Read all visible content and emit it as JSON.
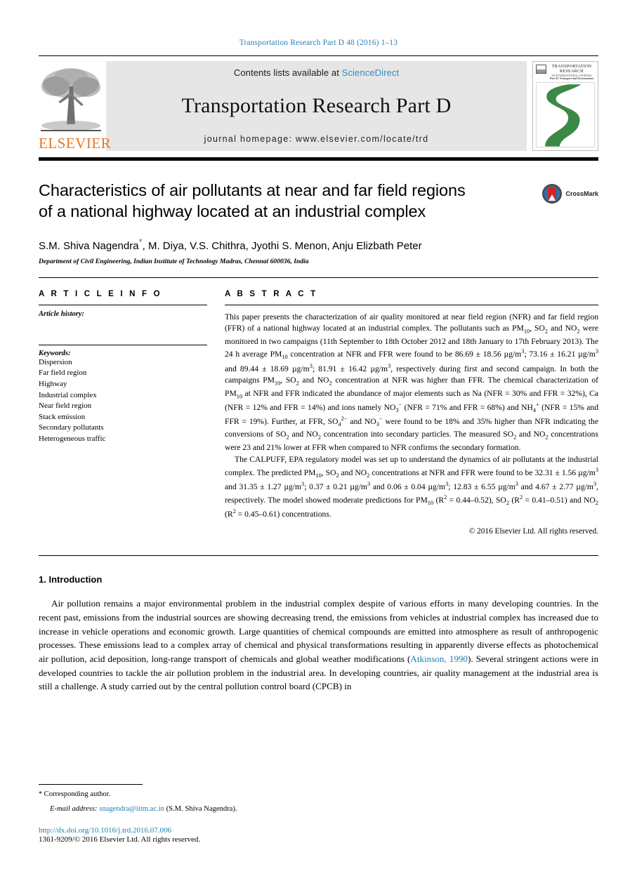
{
  "running_head": "Transportation Research Part D 48 (2016) 1–13",
  "masthead": {
    "publisher_name": "ELSEVIER",
    "contents_prefix": "Contents lists available at",
    "contents_link": "ScienceDirect",
    "journal_title": "Transportation Research Part D",
    "homepage": "journal homepage: www.elsevier.com/locate/trd",
    "cover": {
      "line1": "TRANSPORTATION",
      "line2": "RESEARCH",
      "line3": "AN INTERNATIONAL JOURNAL",
      "line4": "Part D: Transport and Environment"
    }
  },
  "article": {
    "title_line1": "Characteristics of air pollutants at near and far field regions",
    "title_line2": "of a national highway located at an industrial complex",
    "crossmark_label": "CrossMark",
    "authors": "S.M. Shiva Nagendra",
    "authors_rest": ", M. Diya, V.S. Chithra, Jyothi S. Menon, Anju Elizbath Peter",
    "corresponding_marker": "*",
    "affiliation": "Department of Civil Engineering, Indian Institute of Technology Madras, Chennai 600036, India"
  },
  "article_info": {
    "heading": "A R T I C L E   I N F O",
    "history_label": "Article history:",
    "keywords_label": "Keywords:",
    "keywords": [
      "Dispersion",
      "Far field region",
      "Highway",
      "Industrial complex",
      "Near field region",
      "Stack emission",
      "Secondary pollutants",
      "Heterogeneous traffic"
    ]
  },
  "abstract": {
    "heading": "A B S T R A C T",
    "paragraph1_a": "This paper presents the characterization of air quality monitored at near field region (NFR) and far field region (FFR) of a national highway located at an industrial complex. The pollutants such as PM",
    "paragraph1_b": ", SO",
    "paragraph1_c": " and NO",
    "paragraph1_d": " were monitored in two campaigns (11th September to 18th October 2012 and 18th January to 17th February 2013). The 24 h average PM",
    "paragraph1_e": " concentration at NFR and FFR were found to be 86.69 ± 18.56 µg/m",
    "paragraph1_f": "; 73.16 ± 16.21 µg/m",
    "paragraph1_g": " and 89.44 ± 18.69 µg/m",
    "paragraph1_h": "; 81.91 ± 16.42 µg/m",
    "paragraph1_i": ", respectively during first and second campaign. In both the campaigns PM",
    "paragraph1_j": " concentration at NFR was higher than FFR. The chemical characterization of PM",
    "paragraph1_k": " at NFR and FFR indicated the abundance of major elements such as Na (NFR = 30% and FFR = 32%), Ca (NFR = 12% and FFR = 14%) and ions namely NO",
    "paragraph1_l": " (NFR = 71% and FFR = 68%) and NH",
    "paragraph1_m": " (NFR = 15% and FFR = 19%). Further, at FFR, SO",
    "paragraph1_n": " and NO",
    "paragraph1_o": " were found to be 18% and 35% higher than NFR indicating the conversions of SO",
    "paragraph1_p": " and NO",
    "paragraph1_q": " concentration into secondary particles. The measured SO",
    "paragraph1_r": " and NO",
    "paragraph1_s": " concentrations were 23 and 21% lower at FFR when compared to NFR confirms the secondary formation.",
    "paragraph2_a": "The CALPUFF, EPA regulatory model was set up to understand the dynamics of air pollutants at the industrial complex. The predicted PM",
    "paragraph2_b": ", SO",
    "paragraph2_c": " and NO",
    "paragraph2_d": " concentrations at NFR and FFR were found to be 32.31 ± 1.56 µg/m",
    "paragraph2_e": " and 31.35 ± 1.27 µg/m",
    "paragraph2_f": "; 0.37 ± 0.21 µg/m",
    "paragraph2_g": " and 0.06 ± 0.04 µg/m",
    "paragraph2_h": "; 12.83 ± 6.55 µg/m",
    "paragraph2_i": " and 4.67 ± 2.77 µg/m",
    "paragraph2_j": ", respectively. The model showed moderate predictions for PM",
    "paragraph2_k": " (R",
    "paragraph2_l": " = 0.44–0.52), SO",
    "paragraph2_m": " (R",
    "paragraph2_n": " = 0.41–0.51) and NO",
    "paragraph2_o": " (R",
    "paragraph2_p": " = 0.45–0.61) concentrations.",
    "copyright": "© 2016 Elsevier Ltd. All rights reserved."
  },
  "introduction": {
    "heading": "1. Introduction",
    "text_a": "Air pollution remains a major environmental problem in the industrial complex despite of various efforts in many developing countries. In the recent past, emissions from the industrial sources are showing decreasing trend, the emissions from vehicles at industrial complex has increased due to increase in vehicle operations and economic growth. Large quantities of chemical compounds are emitted into atmosphere as result of anthropogenic processes. These emissions lead to a complex array of chemical and physical transformations resulting in apparently diverse effects as photochemical air pollution, acid deposition, long-range transport of chemicals and global weather modifications (",
    "citation": "Atkinson, 1990",
    "text_b": "). Several stringent actions were in developed countries to tackle the air pollution problem in the industrial area. In developing countries, air quality management at the industrial area is still a challenge. A study carried out by the central pollution control board (CPCB) in"
  },
  "footer": {
    "corresponding_marker": "*",
    "corresponding_label": "Corresponding author.",
    "email_label": "E-mail address:",
    "email": "snagendra@iitm.ac.in",
    "email_owner": "(S.M. Shiva Nagendra).",
    "doi": "http://dx.doi.org/10.1016/j.trd.2016.07.006",
    "issn": "1361-9209/© 2016 Elsevier Ltd. All rights reserved."
  },
  "colors": {
    "link_blue": "#1a7fb0",
    "running_head_blue": "#2a7fb5",
    "elsevier_orange": "#E87722",
    "masthead_gray": "#e6e6e6",
    "cover_green": "#3a8a45"
  }
}
